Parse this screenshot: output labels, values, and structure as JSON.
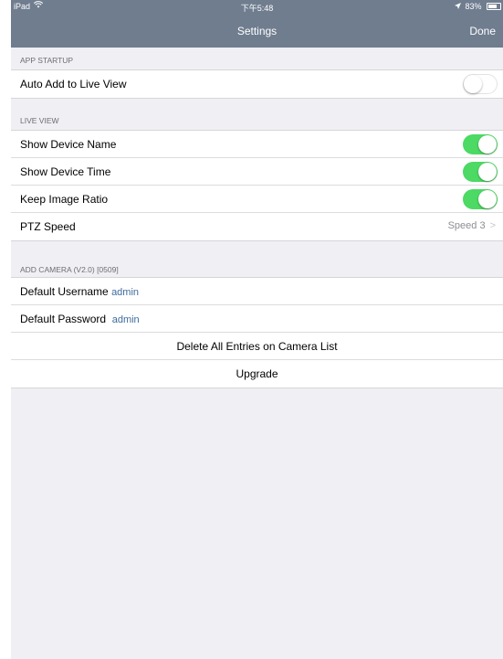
{
  "status_bar": {
    "carrier": "iPad",
    "wifi_icon": "wifi-icon",
    "time": "下午5:48",
    "location_icon": "location-arrow-icon",
    "battery": "83%",
    "battery_icon": "battery-icon"
  },
  "nav": {
    "title": "Settings",
    "done_label": "Done"
  },
  "sections": {
    "app_startup": {
      "header": "APP STARTUP",
      "auto_add_label": "Auto Add to Live View",
      "auto_add_on": false
    },
    "live_view": {
      "header": "LIVE VIEW",
      "show_name_label": "Show Device Name",
      "show_name_on": true,
      "show_time_label": "Show Device Time",
      "show_time_on": true,
      "keep_ratio_label": "Keep Image Ratio",
      "keep_ratio_on": true,
      "ptz_label": "PTZ Speed",
      "ptz_value": "Speed 3",
      "ptz_chevron": ">"
    },
    "add_camera": {
      "header": "ADD CAMERA (V2.0) [0509]",
      "username_label": "Default Username",
      "username_value": "admin",
      "password_label": "Default Password",
      "password_value": "admin",
      "delete_label": "Delete All Entries on Camera List",
      "upgrade_label": "Upgrade"
    }
  },
  "colors": {
    "nav_background": "#6f7d8f",
    "toggle_on": "#4cd964",
    "value_blue": "#3f6c9e",
    "group_background": "#efeff4"
  }
}
